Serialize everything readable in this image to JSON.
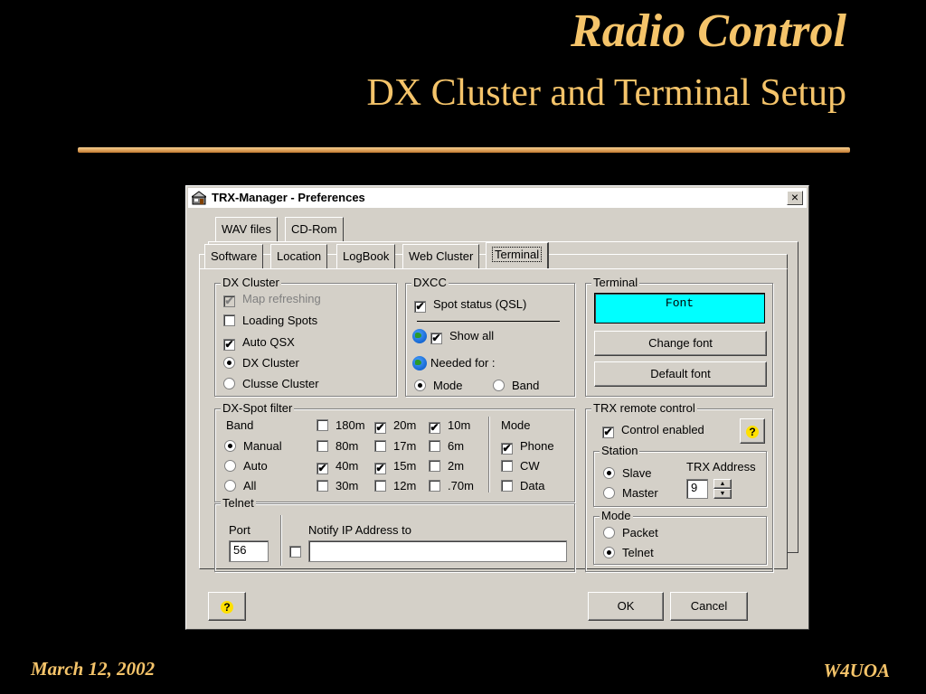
{
  "slide": {
    "title": "Radio Control",
    "subtitle": "DX Cluster and Terminal Setup",
    "date": "March 12, 2002",
    "author": "W4UOA"
  },
  "window": {
    "title": "TRX-Manager - Preferences",
    "close": "×"
  },
  "tabs_back": [
    "WAV files",
    "CD-Rom"
  ],
  "tabs_front": [
    "Software",
    "Location",
    "LogBook",
    "Web Cluster",
    "Terminal"
  ],
  "active_tab": "Terminal",
  "dx_cluster": {
    "legend": "DX Cluster",
    "map_refreshing": "Map refreshing",
    "loading_spots": "Loading Spots",
    "auto_qsx": "Auto QSX",
    "dx_cluster": "DX Cluster",
    "clusse_cluster": "Clusse Cluster"
  },
  "dxcc": {
    "legend": "DXCC",
    "spot_status": "Spot status (QSL)",
    "show_all": "Show all",
    "needed_for": "Needed for :",
    "mode": "Mode",
    "band": "Band"
  },
  "terminal": {
    "legend": "Terminal",
    "font_preview": "Font",
    "preview_color": "#00ffff",
    "change_font": "Change font",
    "default_font": "Default font"
  },
  "spot_filter": {
    "legend": "DX-Spot filter",
    "band_label": "Band",
    "manual": "Manual",
    "auto": "Auto",
    "all": "All",
    "bands": {
      "b180": "180m",
      "b20": "20m",
      "b10": "10m",
      "b80": "80m",
      "b17": "17m",
      "b6": "6m",
      "b40": "40m",
      "b15": "15m",
      "b2": "2m",
      "b30": "30m",
      "b12": "12m",
      "b70": ".70m"
    },
    "mode_label": "Mode",
    "phone": "Phone",
    "cw": "CW",
    "data": "Data"
  },
  "telnet": {
    "legend": "Telnet",
    "port_label": "Port",
    "port_value": "56",
    "notify_label": "Notify IP Address to",
    "notify_value": ""
  },
  "trx_remote": {
    "legend": "TRX remote control",
    "control_enabled": "Control enabled",
    "station_legend": "Station",
    "slave": "Slave",
    "master": "Master",
    "trx_address_label": "TRX Address",
    "trx_address_value": "9",
    "mode_legend": "Mode",
    "packet": "Packet",
    "telnet": "Telnet"
  },
  "buttons": {
    "help": "?",
    "ok": "OK",
    "cancel": "Cancel"
  },
  "checkmark": "✔"
}
